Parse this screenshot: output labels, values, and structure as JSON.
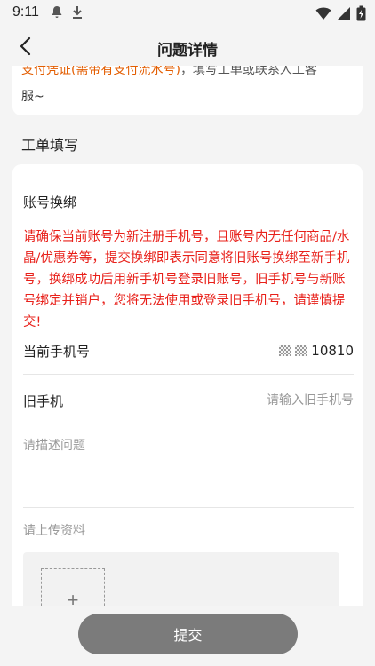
{
  "status_bar": {
    "time": "9:11",
    "icons": [
      "notification-icon",
      "download-icon",
      "wifi-icon",
      "signal-icon",
      "battery-icon"
    ]
  },
  "nav": {
    "title": "问题详情",
    "back_icon": "chevron-left-icon"
  },
  "top_card": {
    "line1_orange": "支付凭证(需带有支付流水号)",
    "line1_gray": "，填写工单或联系人工客",
    "line2": "服~"
  },
  "section_title": "工单填写",
  "form": {
    "heading": "账号换绑",
    "warning": "请确保当前账号为新注册手机号，且账号内无任何商品/水晶/优惠券等，提交换绑即表示同意将旧账号换绑至新手机号，换绑成功后用新手机号登录旧账号，旧手机号与新账号绑定并销户，您将无法使用或登录旧手机号，请谨慎提交!",
    "current_phone_label": "当前手机号",
    "current_phone_value": "10810",
    "old_phone_label": "旧手机",
    "old_phone_placeholder": "请输入旧手机号",
    "old_phone_value": "",
    "description_placeholder": "请描述问题",
    "upload_label": "请上传资料",
    "upload_plus": "+"
  },
  "submit_label": "提交",
  "colors": {
    "warning": "#e8201a",
    "accent_orange": "#e35d00",
    "submit_button": "#7b7b7b",
    "background": "#f4f4f4"
  }
}
